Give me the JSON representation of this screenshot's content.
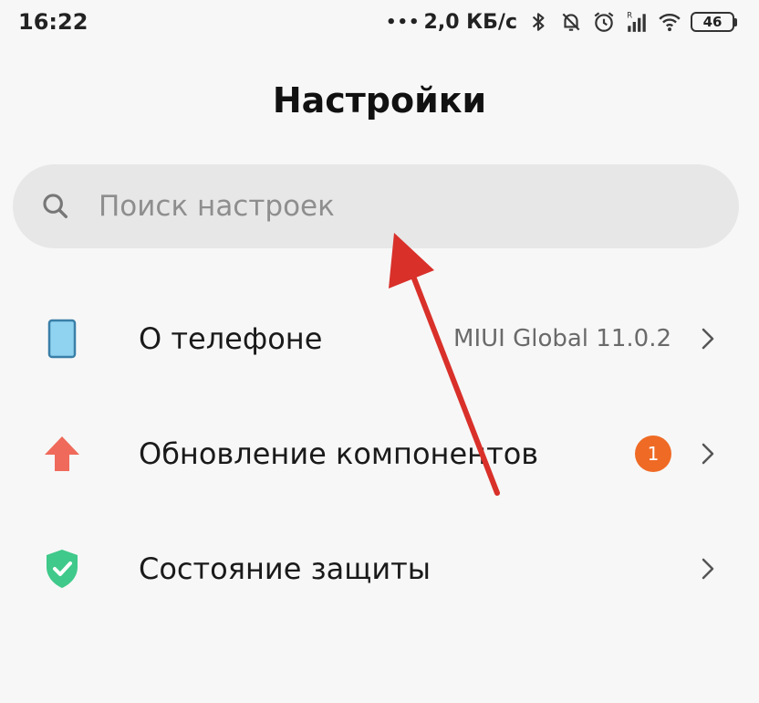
{
  "status_bar": {
    "time": "16:22",
    "network_speed": "2,0 КБ/с",
    "battery_level": "46",
    "icons": [
      "bluetooth-icon",
      "mute-icon",
      "alarm-icon",
      "signal-icon",
      "wifi-icon",
      "battery-icon"
    ]
  },
  "header": {
    "title": "Настройки"
  },
  "search": {
    "placeholder": "Поиск настроек",
    "value": ""
  },
  "settings_items": [
    {
      "label": "О телефоне",
      "value": "MIUI Global 11.0.2",
      "icon": "phone-icon"
    },
    {
      "label": "Обновление компонентов",
      "badge": "1",
      "icon": "update-arrow-icon"
    },
    {
      "label": "Состояние защиты",
      "icon": "shield-check-icon"
    }
  ],
  "colors": {
    "background": "#f7f7f7",
    "search_background": "#e7e7e7",
    "phone_icon": "#8fd3f0",
    "update_icon": "#ef6a5a",
    "badge": "#ef6a24",
    "shield": "#3fc98a",
    "annotation_arrow": "#d9302a"
  }
}
